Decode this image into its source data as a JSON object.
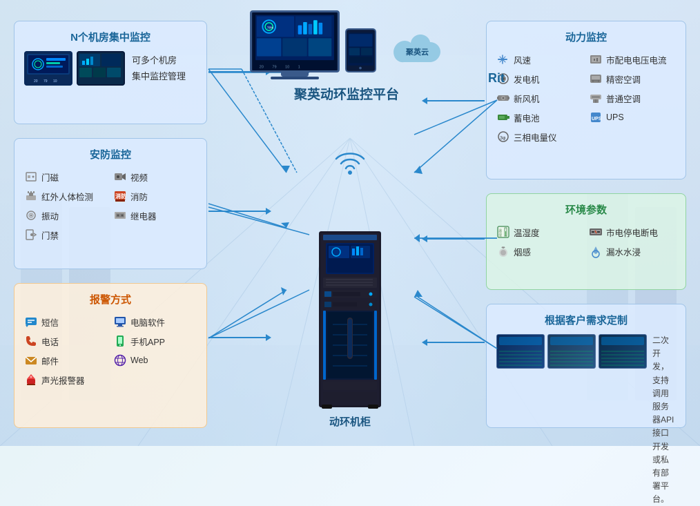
{
  "bg": {
    "color": "#e8f4fb"
  },
  "cloud_platform": {
    "title": "聚英动环监控平台",
    "cloud_name": "聚英云"
  },
  "cabinet": {
    "title": "动环机柜"
  },
  "panels": {
    "n_monitor": {
      "title": "N个机房集中监控",
      "desc_line1": "可多个机房",
      "desc_line2": "集中监控管理"
    },
    "security": {
      "title": "安防监控",
      "items": [
        {
          "icon": "🔲",
          "label": "门磁"
        },
        {
          "icon": "📹",
          "label": "视频"
        },
        {
          "icon": "🛒",
          "label": "红外人体检测"
        },
        {
          "icon": "🚒",
          "label": "消防"
        },
        {
          "icon": "📳",
          "label": "振动"
        },
        {
          "icon": "📟",
          "label": "继电器"
        },
        {
          "icon": "🚪",
          "label": "门禁"
        }
      ]
    },
    "alarm": {
      "title": "报警方式",
      "items": [
        {
          "icon": "💬",
          "label": "短信",
          "color": "#2288cc"
        },
        {
          "icon": "🖥",
          "label": "电脑软件",
          "color": "#2255aa"
        },
        {
          "icon": "📞",
          "label": "电话",
          "color": "#cc4422"
        },
        {
          "icon": "📱",
          "label": "手机APP",
          "color": "#22aa55"
        },
        {
          "icon": "✉",
          "label": "邮件",
          "color": "#cc8822"
        },
        {
          "icon": "🌐",
          "label": "Web",
          "color": "#5522aa"
        },
        {
          "icon": "🔔",
          "label": "声光报警器",
          "color": "#cc2222"
        }
      ]
    },
    "power": {
      "title": "动力监控",
      "items": [
        {
          "icon": "🌬",
          "label": "风速"
        },
        {
          "icon": "⚡",
          "label": "市配电电压电流"
        },
        {
          "icon": "⚙",
          "label": "发电机"
        },
        {
          "icon": "❄",
          "label": "精密空调"
        },
        {
          "icon": "💨",
          "label": "新风机"
        },
        {
          "icon": "🌀",
          "label": "普通空调"
        },
        {
          "icon": "🔋",
          "label": "蓄电池"
        },
        {
          "icon": "🔌",
          "label": "UPS"
        },
        {
          "icon": "📊",
          "label": "三相电量仪"
        }
      ]
    },
    "env": {
      "title": "环境参数",
      "items": [
        {
          "icon": "🌡",
          "label": "温湿度"
        },
        {
          "icon": "⚡",
          "label": "市电停电断电"
        },
        {
          "icon": "💨",
          "label": "烟感"
        },
        {
          "icon": "💧",
          "label": "漏水水浸"
        }
      ]
    },
    "custom": {
      "title": "根据客户需求定制",
      "desc": "二次开发，支持调用服务器API接口开发或私有部署平台。"
    }
  },
  "rit_label": "Rit"
}
